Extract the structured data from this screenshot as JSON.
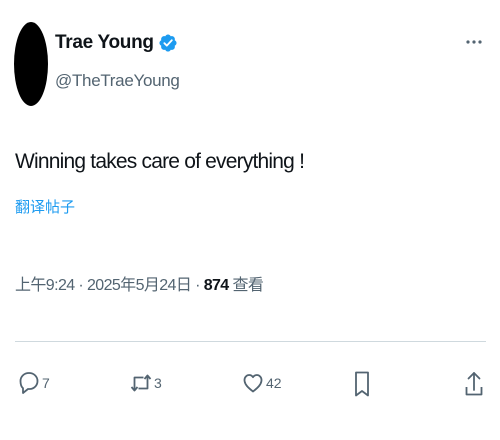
{
  "author": {
    "display_name": "Trae Young",
    "handle": "@TheTraeYoung",
    "verified": true
  },
  "tweet": {
    "text": "Winning takes care of everything !",
    "translate_label": "翻译帖子"
  },
  "meta": {
    "time": "上午9:24",
    "separator1": " · ",
    "date": "2025年5月24日",
    "separator2": " · ",
    "views_count": "874",
    "views_label": " 查看"
  },
  "actions": {
    "reply_count": "7",
    "retweet_count": "3",
    "like_count": "42"
  },
  "colors": {
    "verified": "#1d9bf0",
    "link": "#1d9bf0",
    "muted": "#536471",
    "icon": "#536471"
  }
}
